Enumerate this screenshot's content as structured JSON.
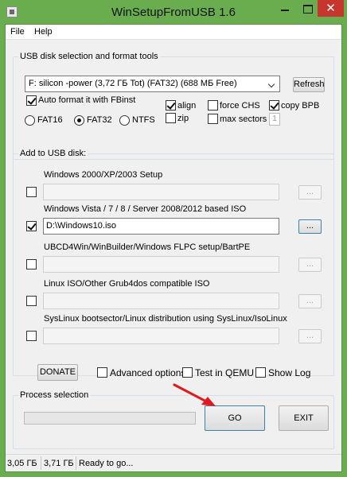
{
  "window": {
    "title": "WinSetupFromUSB 1.6"
  },
  "menu": {
    "file": "File",
    "help": "Help"
  },
  "usb_group": {
    "title": "USB disk selection and format tools",
    "disk_selected": "F: silicon -power (3,72 ГБ Tot) (FAT32) (688 МБ Free)",
    "refresh_label": "Refresh",
    "auto_format_label": "Auto format it with FBinst",
    "auto_format_checked": true,
    "fat16_label": "FAT16",
    "fat32_label": "FAT32",
    "ntfs_label": "NTFS",
    "filesystem_selected": "FAT32",
    "align_label": "align",
    "align_checked": true,
    "zip_label": "zip",
    "zip_checked": false,
    "force_chs_label": "force CHS",
    "force_chs_checked": false,
    "max_sectors_label": "max sectors",
    "max_sectors_checked": false,
    "max_sectors_value": "1",
    "copy_bpb_label": "copy BPB",
    "copy_bpb_checked": true
  },
  "add_group": {
    "title": "Add to USB disk:",
    "browse_label": "...",
    "sources": [
      {
        "label": "Windows 2000/XP/2003 Setup",
        "checked": false,
        "path": ""
      },
      {
        "label": "Windows Vista / 7 / 8 / Server 2008/2012 based ISO",
        "checked": true,
        "path": "D:\\Windows10.iso"
      },
      {
        "label": "UBCD4Win/WinBuilder/Windows FLPC setup/BartPE",
        "checked": false,
        "path": ""
      },
      {
        "label": "Linux ISO/Other Grub4dos compatible ISO",
        "checked": false,
        "path": ""
      },
      {
        "label": "SysLinux bootsector/Linux distribution using SysLinux/IsoLinux",
        "checked": false,
        "path": ""
      }
    ]
  },
  "options": {
    "donate_label": "DONATE",
    "advanced_label": "Advanced options",
    "advanced_checked": false,
    "qemu_label": "Test in QEMU",
    "qemu_checked": false,
    "showlog_label": "Show Log",
    "showlog_checked": false
  },
  "process": {
    "title": "Process selection",
    "progress": 0,
    "go_label": "GO",
    "exit_label": "EXIT"
  },
  "status": {
    "cell1": "3,05 ГБ",
    "cell2": "3,71 ГБ",
    "cell3": "Ready to go..."
  },
  "colors": {
    "window_frame": "#69ad4f",
    "close_button": "#c7352f",
    "annotation_arrow": "#e0191f"
  }
}
